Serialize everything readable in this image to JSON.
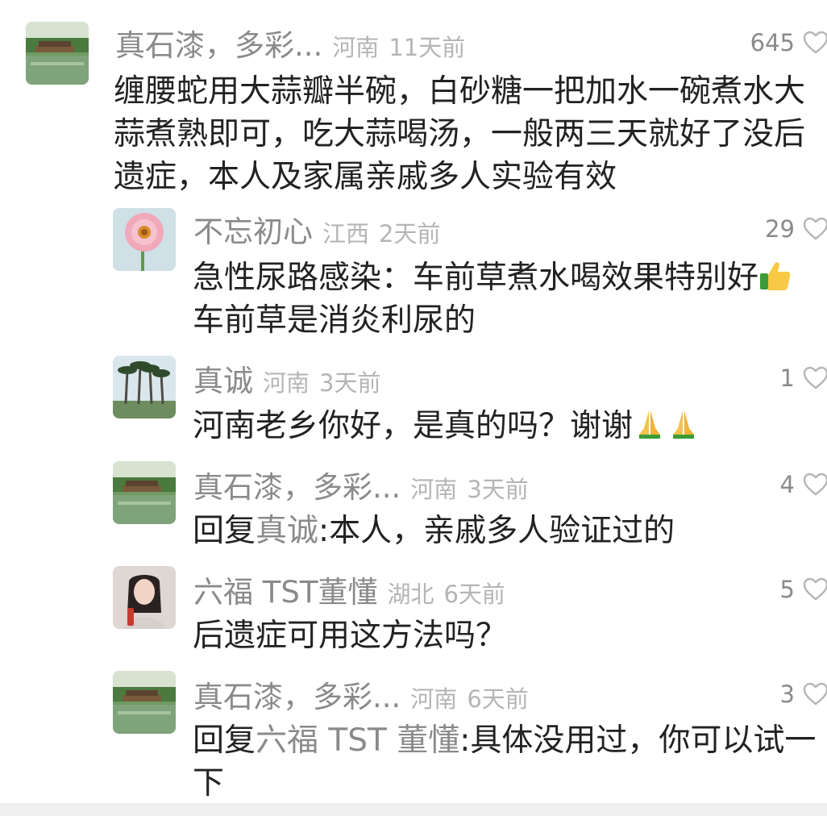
{
  "comments": [
    {
      "user": "真石漆，多彩...",
      "region": "河南",
      "time": "11天前",
      "likes": "645",
      "text": "缠腰蛇用大蒜瓣半碗，白砂糖一把加水一碗煮水大蒜煮熟即可，吃大蒜喝汤，一般两三天就好了没后遗症，本人及家属亲戚多人实验有效",
      "avatar_icon": "garden-pavilion-avatar"
    },
    {
      "user": "不忘初心",
      "region": "江西",
      "time": "2天前",
      "likes": "29",
      "text": "急性尿路感染：车前草煮水喝效果特别好",
      "text_line2": "车前草是消炎利尿的",
      "emoji_icon": "thumbs-up-emoji",
      "avatar_icon": "pink-flower-avatar"
    },
    {
      "user": "真诚",
      "region": "河南",
      "time": "3天前",
      "likes": "1",
      "text": "河南老乡你好，是真的吗？谢谢",
      "emoji_icon": "praying-hands-emoji",
      "avatar_icon": "palm-trees-avatar"
    },
    {
      "user": "真石漆，多彩...",
      "region": "河南",
      "time": "3天前",
      "likes": "4",
      "reply_prefix": "回复",
      "reply_target": "真诚",
      "text": ":本人，亲戚多人验证过的",
      "avatar_icon": "garden-pavilion-avatar"
    },
    {
      "user": "六福 TST董懂",
      "region": "湖北",
      "time": "6天前",
      "likes": "5",
      "text": "后遗症可用这方法吗？",
      "avatar_icon": "woman-portrait-avatar"
    },
    {
      "user": "真石漆，多彩...",
      "region": "河南",
      "time": "6天前",
      "likes": "3",
      "reply_prefix": "回复",
      "reply_target": "六福 TST 董懂",
      "text": ":具体没用过，你可以试一下",
      "avatar_icon": "garden-pavilion-avatar"
    }
  ],
  "colors": {
    "username": "#8a8a8a",
    "meta": "#b5b5b5",
    "text": "#222222"
  }
}
